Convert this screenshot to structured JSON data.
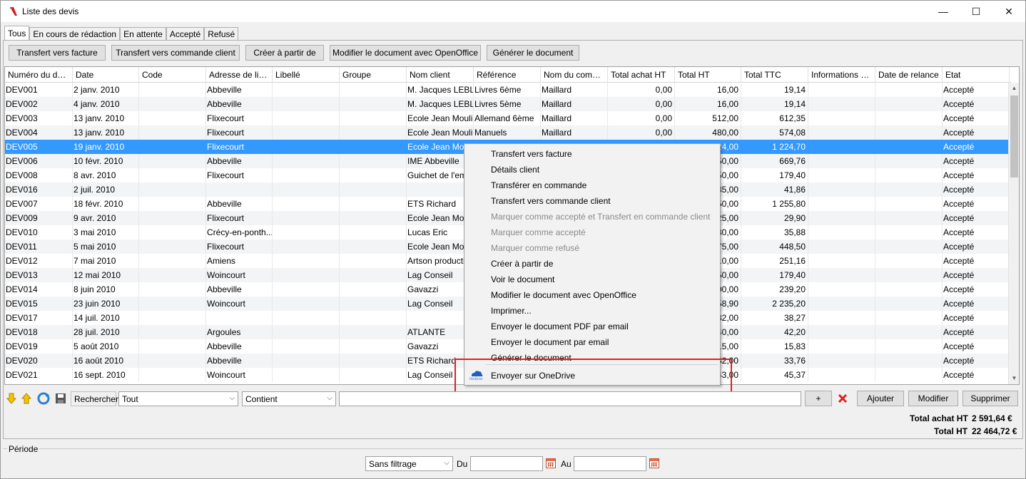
{
  "window": {
    "title": "Liste des devis",
    "minimize": "—",
    "maximize": "☐",
    "close": "✕"
  },
  "tabs": [
    "Tous",
    "En cours de rédaction",
    "En attente",
    "Accepté",
    "Refusé"
  ],
  "toolbar": [
    "Transfert vers facture",
    "Transfert vers commande client",
    "Créer à partir de",
    "Modifier le document avec OpenOffice",
    "Générer le document"
  ],
  "columns": [
    "Numéro du devis",
    "Date",
    "Code",
    "Adresse de livr...",
    "Libellé",
    "Groupe",
    "Nom client",
    "Référence",
    "Nom du comme...",
    "Total achat HT",
    "Total HT",
    "Total TTC",
    "Informations c...",
    "Date de relance",
    "Etat"
  ],
  "rows": [
    [
      "DEV001",
      "2 janv. 2010",
      "",
      "Abbeville",
      "",
      "",
      "M. Jacques LEBL...",
      "Livres 6ème",
      "Maillard",
      "0,00",
      "16,00",
      "19,14",
      "",
      "",
      "Accepté"
    ],
    [
      "DEV002",
      "4 janv. 2010",
      "",
      "Abbeville",
      "",
      "",
      "M. Jacques LEBL...",
      "Livres 5ème",
      "Maillard",
      "0,00",
      "16,00",
      "19,14",
      "",
      "",
      "Accepté"
    ],
    [
      "DEV003",
      "13 janv. 2010",
      "",
      "Flixecourt",
      "",
      "",
      "Ecole Jean Moulin",
      "Allemand 6ème",
      "Maillard",
      "0,00",
      "512,00",
      "612,35",
      "",
      "",
      "Accepté"
    ],
    [
      "DEV004",
      "13 janv. 2010",
      "",
      "Flixecourt",
      "",
      "",
      "Ecole Jean Moulin",
      "Manuels",
      "Maillard",
      "0,00",
      "480,00",
      "574,08",
      "",
      "",
      "Accepté"
    ],
    [
      "DEV005",
      "19 janv. 2010",
      "",
      "Flixecourt",
      "",
      "",
      "Ecole Jean Mouli",
      "",
      "",
      "",
      "24,00",
      "1 224,70",
      "",
      "",
      "Accepté"
    ],
    [
      "DEV006",
      "10 févr. 2010",
      "",
      "Abbeville",
      "",
      "",
      "IME Abbeville",
      "",
      "",
      "",
      "50,00",
      "669,76",
      "",
      "",
      "Accepté"
    ],
    [
      "DEV008",
      "8 avr. 2010",
      "",
      "Flixecourt",
      "",
      "",
      "Guichet de l'emp",
      "",
      "",
      "",
      "50,00",
      "179,40",
      "",
      "",
      "Accepté"
    ],
    [
      "DEV016",
      "2 juil. 2010",
      "",
      "",
      "",
      "",
      "",
      "",
      "",
      "",
      "35,00",
      "41,86",
      "",
      "",
      "Accepté"
    ],
    [
      "DEV007",
      "18 févr. 2010",
      "",
      "Abbeville",
      "",
      "",
      "ETS Richard",
      "",
      "",
      "",
      "50,00",
      "1 255,80",
      "",
      "",
      "Accepté"
    ],
    [
      "DEV009",
      "9 avr. 2010",
      "",
      "Flixecourt",
      "",
      "",
      "Ecole Jean Mouli",
      "",
      "",
      "",
      "25,00",
      "29,90",
      "",
      "",
      "Accepté"
    ],
    [
      "DEV010",
      "3 mai 2010",
      "",
      "Crécy-en-ponth...",
      "",
      "",
      "Lucas Eric",
      "",
      "",
      "",
      "30,00",
      "35,88",
      "",
      "",
      "Accepté"
    ],
    [
      "DEV011",
      "5 mai 2010",
      "",
      "Flixecourt",
      "",
      "",
      "Ecole Jean Mouli",
      "",
      "",
      "",
      "75,00",
      "448,50",
      "",
      "",
      "Accepté"
    ],
    [
      "DEV012",
      "7 mai 2010",
      "",
      "Amiens",
      "",
      "",
      "Artson production",
      "",
      "",
      "",
      "10,00",
      "251,16",
      "",
      "",
      "Accepté"
    ],
    [
      "DEV013",
      "12 mai 2010",
      "",
      "Woincourt",
      "",
      "",
      "Lag Conseil",
      "",
      "",
      "",
      "50,00",
      "179,40",
      "",
      "",
      "Accepté"
    ],
    [
      "DEV014",
      "8 juin 2010",
      "",
      "Abbeville",
      "",
      "",
      "Gavazzi",
      "",
      "",
      "",
      "00,00",
      "239,20",
      "",
      "",
      "Accepté"
    ],
    [
      "DEV015",
      "23 juin 2010",
      "",
      "Woincourt",
      "",
      "",
      "Lag Conseil",
      "",
      "",
      "",
      "58,90",
      "2 235,20",
      "",
      "",
      "Accepté"
    ],
    [
      "DEV017",
      "14 juil. 2010",
      "",
      "",
      "",
      "",
      "",
      "",
      "",
      "",
      "32,00",
      "38,27",
      "",
      "",
      "Accepté"
    ],
    [
      "DEV018",
      "28 juil. 2010",
      "",
      "Argoules",
      "",
      "",
      "ATLANTE",
      "",
      "",
      "",
      "40,00",
      "42,20",
      "",
      "",
      "Accepté"
    ],
    [
      "DEV019",
      "5 août 2010",
      "",
      "Abbeville",
      "",
      "",
      "Gavazzi",
      "",
      "",
      "",
      "15,00",
      "15,83",
      "",
      "",
      "Accepté"
    ],
    [
      "DEV020",
      "16 août 2010",
      "",
      "Abbeville",
      "",
      "",
      "ETS Richard",
      "",
      "",
      "",
      "32,00",
      "33,76",
      "",
      "",
      "Accepté"
    ],
    [
      "DEV021",
      "16 sept. 2010",
      "",
      "Woincourt",
      "",
      "",
      "Lag Conseil",
      "",
      "",
      "",
      "43,00",
      "45,37",
      "",
      "",
      "Accepté"
    ]
  ],
  "context_menu": [
    {
      "label": "Transfert vers facture",
      "disabled": false
    },
    {
      "label": "Détails client",
      "disabled": false
    },
    {
      "label": "Transférer en commande",
      "disabled": false
    },
    {
      "label": "Transfert vers commande client",
      "disabled": false
    },
    {
      "label": "Marquer comme accepté et Transfert en commande client",
      "disabled": true
    },
    {
      "label": "Marquer comme accepté",
      "disabled": true
    },
    {
      "label": "Marquer comme refusé",
      "disabled": true
    },
    {
      "label": "Créer à partir de",
      "disabled": false
    },
    {
      "label": "Voir le document",
      "disabled": false
    },
    {
      "label": "Modifier le document avec OpenOffice",
      "disabled": false
    },
    {
      "label": "Imprimer...",
      "disabled": false
    },
    {
      "label": "Envoyer le document PDF par email",
      "disabled": false
    },
    {
      "label": "Envoyer le document par email",
      "disabled": false
    },
    {
      "label": "Générer le document",
      "disabled": false
    },
    {
      "label": "Envoyer sur OneDrive",
      "disabled": false
    }
  ],
  "onedrive_icon_text": "OneDrive",
  "search": {
    "label": "Rechercher",
    "scope": "Tout",
    "operator": "Contient",
    "value": "",
    "add": "+"
  },
  "actions": {
    "add": "Ajouter",
    "edit": "Modifier",
    "delete": "Supprimer"
  },
  "totals": {
    "achat_label": "Total achat HT",
    "achat_value": "2 591,64 €",
    "ht_label": "Total HT",
    "ht_value": "22 464,72 €"
  },
  "periode": {
    "label": "Période",
    "filter": "Sans filtrage",
    "du": "Du",
    "au": "Au",
    "du_value": "",
    "au_value": ""
  },
  "colors": {
    "selection": "#3399ff",
    "highlight_box": "#e02020"
  }
}
